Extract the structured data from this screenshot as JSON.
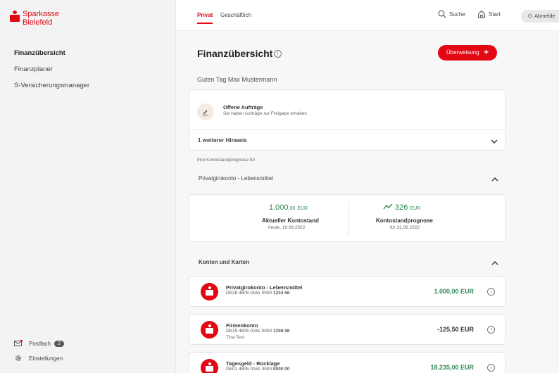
{
  "brand": {
    "line1": "Sparkasse",
    "line2": "Bielefeld",
    "color": "#e30613"
  },
  "sidebar": {
    "items": [
      {
        "label": "Finanzübersicht",
        "active": true
      },
      {
        "label": "Finanzplaner"
      },
      {
        "label": "S-Versicherungsmanager"
      }
    ],
    "postfach": {
      "label": "Postfach",
      "count": "2"
    },
    "settings": {
      "label": "Einstellungen"
    }
  },
  "topbar": {
    "tabs": [
      {
        "label": "Privat",
        "active": true
      },
      {
        "label": "Geschäftlich"
      }
    ],
    "search_label": "Suche",
    "start_label": "Start",
    "logout_label": "Abmelde"
  },
  "main": {
    "title": "Finanzübersicht",
    "info_glyph": "i",
    "transfer_label": "Überweisung",
    "transfer_plus": "+",
    "greeting": "Guten Tag Max Mustermann",
    "open_orders": {
      "title": "Offene Aufträge",
      "subtitle": "Sie haben Aufträge zur Freigabe erhalten"
    },
    "more_hint": "1 weiterer Hinweis",
    "forecast_caption": "Ihre Kontostandprognose für",
    "forecast_account": "Privatgirokonto - Lebensmittel",
    "current": {
      "amount": "1.000",
      "decimals": ",00",
      "currency": "EUR",
      "label": "Aktueller Kontostand",
      "date": "heute, 19.08.2022"
    },
    "forecast": {
      "amount": "326",
      "currency": "EUR",
      "label": "Kontostandprognose",
      "date": "für 31.08.2022"
    },
    "accounts_header": "Konten und Karten",
    "accounts": [
      {
        "name": "Privatgirokonto - Lebensmittel",
        "iban_prefix": "DE28 4805 0161 0000",
        "iban_suffix": "1234 56",
        "holder": "",
        "amount": "1.000,00 EUR",
        "positive": true
      },
      {
        "name": "Firmenkonto",
        "iban_prefix": "DE15 4805 0161 0000",
        "iban_suffix": "1299 98",
        "holder": "Tina Test",
        "amount": "-125,50 EUR",
        "positive": false
      },
      {
        "name": "Tagesgeld - Rücklage",
        "iban_prefix": "DE01 4805 0161 0000",
        "iban_suffix": "0000 00",
        "holder": "",
        "amount": "18.235,00 EUR",
        "positive": true
      }
    ]
  }
}
